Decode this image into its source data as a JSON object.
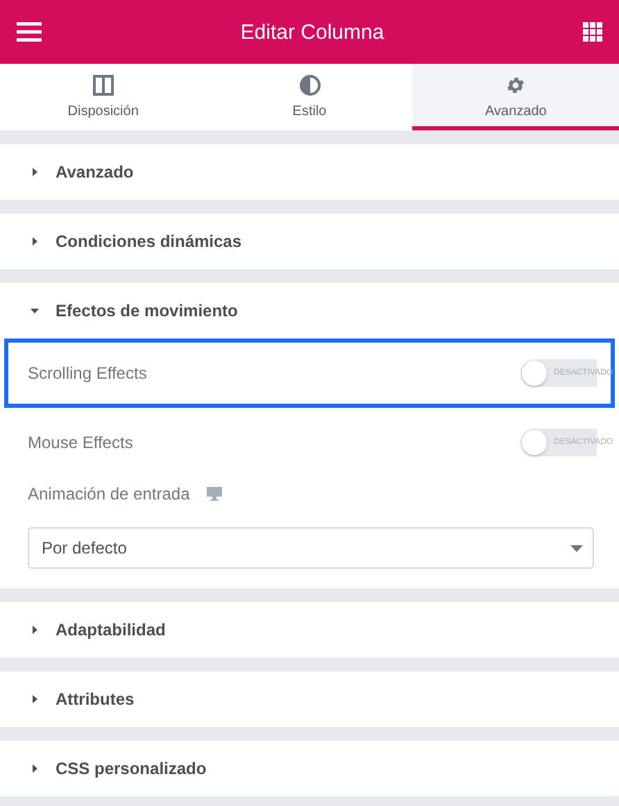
{
  "header": {
    "title": "Editar Columna"
  },
  "tabs": [
    {
      "label": "Disposición",
      "selected": false
    },
    {
      "label": "Estilo",
      "selected": false
    },
    {
      "label": "Avanzado",
      "selected": true
    }
  ],
  "sections": [
    {
      "title": "Avanzado",
      "expanded": false
    },
    {
      "title": "Condiciones dinámicas",
      "expanded": false
    },
    {
      "title": "Efectos de movimiento",
      "expanded": true,
      "controls": [
        {
          "kind": "switch",
          "label": "Scrolling Effects",
          "state_label": "DESACTIVADO",
          "on": false,
          "highlighted": true
        },
        {
          "kind": "switch",
          "label": "Mouse Effects",
          "state_label": "DESACTIVADO",
          "on": false,
          "highlighted": false
        },
        {
          "kind": "select",
          "label": "Animación de entrada",
          "value": "Por defecto"
        }
      ]
    },
    {
      "title": "Adaptabilidad",
      "expanded": false
    },
    {
      "title": "Attributes",
      "expanded": false
    },
    {
      "title": "CSS personalizado",
      "expanded": false
    }
  ]
}
